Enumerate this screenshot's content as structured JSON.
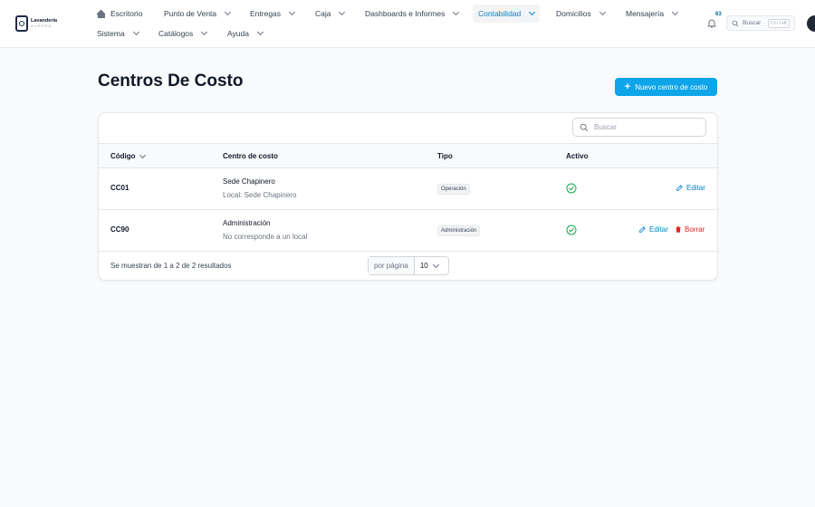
{
  "brand": {
    "name": "Lavandería",
    "sub": "AURORA"
  },
  "nav": {
    "escritorio": "Escritorio",
    "punto_venta": "Punto de Venta",
    "entregas": "Entregas",
    "caja": "Caja",
    "dashboards": "Dashboards e Informes",
    "contabilidad": "Contabilidad",
    "domicilios": "Domicilios",
    "mensajeria": "Mensajería",
    "sistema": "Sistema",
    "catalogos": "Catálogos",
    "ayuda": "Ayuda"
  },
  "notifications": {
    "count": "63"
  },
  "global_search": {
    "label": "Buscar",
    "shortcut": "Ctrl+K"
  },
  "page": {
    "title": "Centros De Costo",
    "new_button": "Nuevo centro de costo"
  },
  "table": {
    "search_placeholder": "Buscar",
    "headers": {
      "codigo": "Código",
      "centro": "Centro de costo",
      "tipo": "Tipo",
      "activo": "Activo"
    },
    "rows": [
      {
        "code": "CC01",
        "name": "Sede Chapinero",
        "sub": "Local: Sede Chapinero",
        "type": "Operación",
        "active": true,
        "edit": "Editar"
      },
      {
        "code": "CC90",
        "name": "Administración",
        "sub": "No corresponde a un local",
        "type": "Administración",
        "active": true,
        "edit": "Editar",
        "delete": "Borrar"
      }
    ],
    "footer": "Se muestran de 1 a 2 de 2 resultados",
    "per_page_label": "por página",
    "per_page_value": "10"
  },
  "colors": {
    "accent": "#0ea5e9",
    "link": "#0284c7",
    "danger": "#dc2626",
    "success": "#16a34a"
  }
}
